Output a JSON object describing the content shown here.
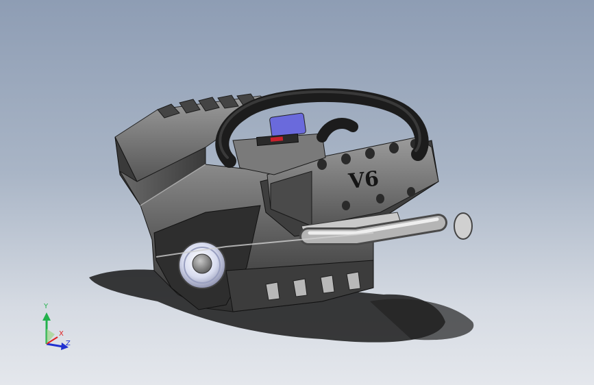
{
  "viewport": {
    "engine_label": "V6"
  },
  "triad": {
    "y_label": "Y",
    "x_label": "X",
    "z_label": "Z",
    "colors": {
      "y": "#22b14c",
      "x": "#e02020",
      "z": "#2030d0"
    }
  }
}
